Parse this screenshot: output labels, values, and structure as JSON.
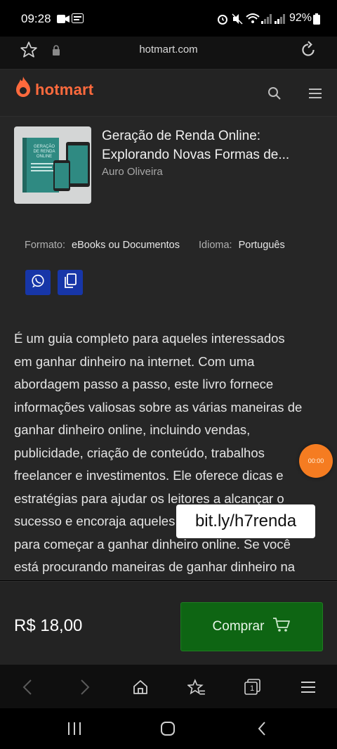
{
  "status_bar": {
    "time": "09:28",
    "battery": "92%",
    "icons": [
      "video-icon",
      "notification-icon",
      "alarm-icon",
      "mute-icon",
      "wifi-icon",
      "signal-icon",
      "signal-icon",
      "battery-icon"
    ]
  },
  "browser": {
    "url": "hotmart.com",
    "nav_icons": [
      "back-icon",
      "forward-icon",
      "home-icon",
      "bookmark-star-icon",
      "tabs-icon",
      "menu-icon"
    ],
    "tabs_count": "1"
  },
  "header": {
    "logo_text": "hotmart",
    "brand_color": "#ff6a3d"
  },
  "product": {
    "title_line1": "Geração de Renda Online:",
    "title_line2": "Explorando Novas Formas de...",
    "author": "Auro Oliveira",
    "format_label": "Formato:",
    "format_value": "eBooks ou Documentos",
    "language_label": "Idioma:",
    "language_value": "Português",
    "cover_text": "GERAÇÃO DE RENDA ONLINE"
  },
  "description_lines": [
    "É um guia completo para aqueles interessados",
    "em ganhar dinheiro na internet. Com uma",
    "abordagem passo a passo, este livro fornece",
    "informações valiosas sobre as várias maneiras de",
    "ganhar dinheiro online, incluindo vendas,",
    "publicidade, criação de conteúdo, trabalhos",
    "freelancer e investimentos. Ele oferece dicas e",
    "estratégias para ajudar os leitores a alcançar o",
    "sucesso e encoraja aqueles",
    "para começar a ganhar dinheiro online. Se você",
    "está procurando maneiras de ganhar dinheiro na"
  ],
  "overlay": {
    "link_text": "bit.ly/h7renda",
    "timer_text": "00:00"
  },
  "footer": {
    "price": "R$ 18,00",
    "buy_label": "Comprar",
    "buy_color": "#0e6513"
  }
}
